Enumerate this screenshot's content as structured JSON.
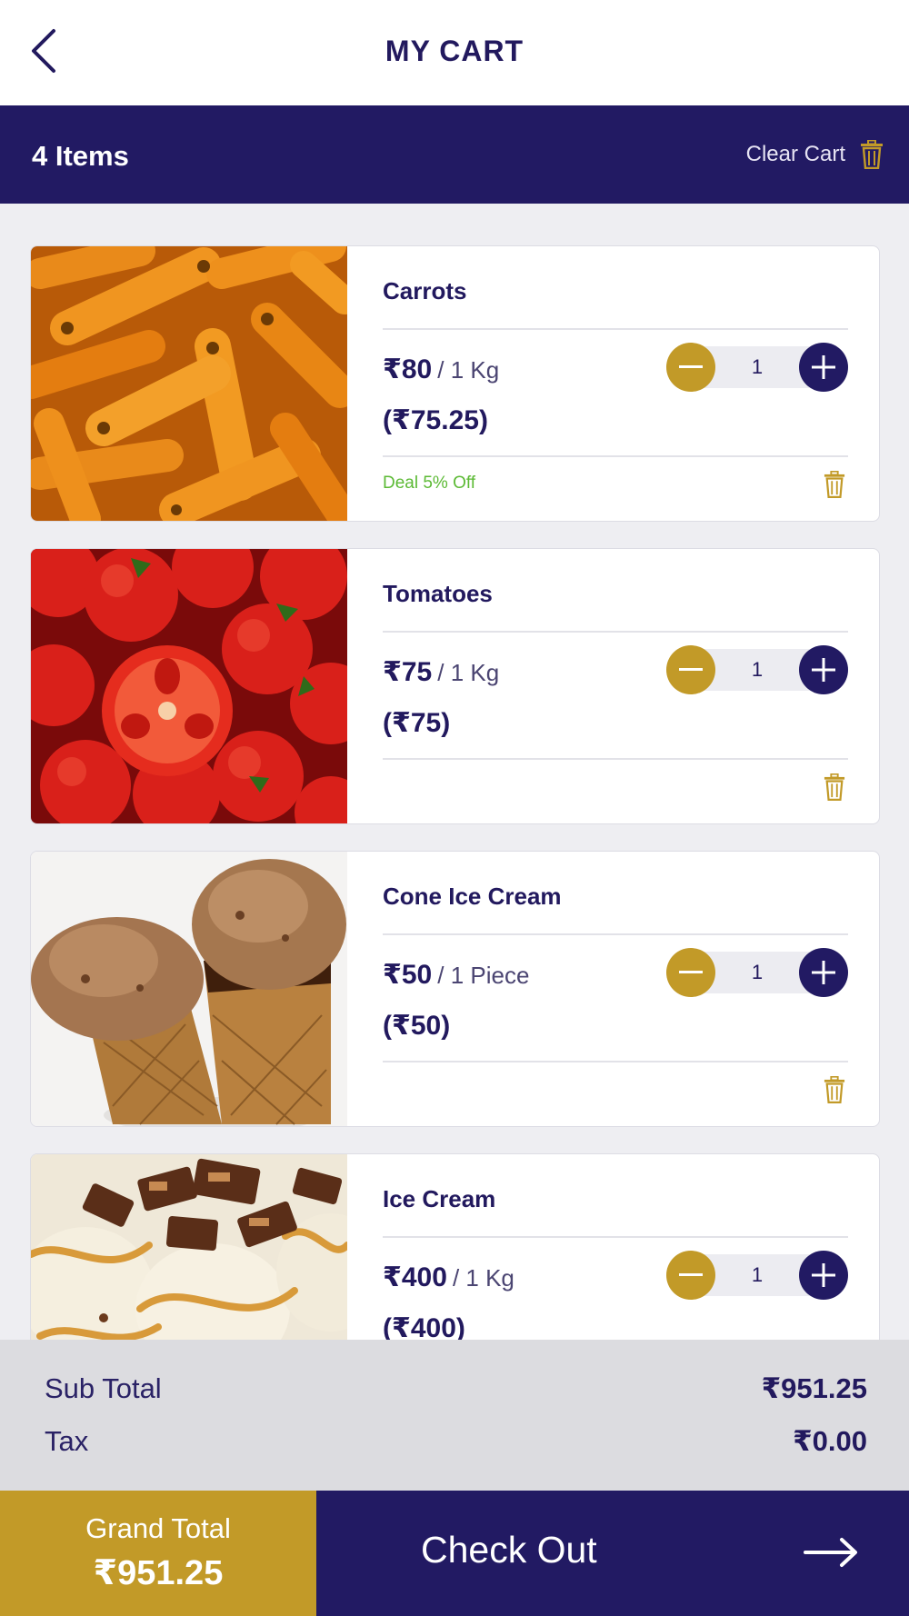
{
  "header": {
    "title": "MY CART",
    "back_icon": "chevron-left-icon"
  },
  "items_bar": {
    "count_label": "4 Items",
    "clear_cart_label": "Clear Cart",
    "clear_cart_icon": "trash-icon"
  },
  "items": [
    {
      "name": "Carrots",
      "price": "₹80",
      "unit": "/ 1 Kg",
      "effective_price": "(₹75.25)",
      "quantity": "1",
      "deal": "Deal 5% Off",
      "image": "carrots"
    },
    {
      "name": "Tomatoes",
      "price": "₹75",
      "unit": "/ 1 Kg",
      "effective_price": "(₹75)",
      "quantity": "1",
      "deal": "",
      "image": "tomatoes"
    },
    {
      "name": "Cone Ice Cream",
      "price": "₹50",
      "unit": "/ 1 Piece",
      "effective_price": "(₹50)",
      "quantity": "1",
      "deal": "",
      "image": "cone-ice-cream"
    },
    {
      "name": "Ice Cream",
      "price": "₹400",
      "unit": "/ 1 Kg",
      "effective_price": "(₹400)",
      "quantity": "1",
      "deal": "",
      "image": "ice-cream"
    }
  ],
  "totals": {
    "subtotal_label": "Sub Total",
    "subtotal_value": "₹951.25",
    "tax_label": "Tax",
    "tax_value": "₹0.00"
  },
  "footer": {
    "grand_total_label": "Grand Total",
    "grand_total_value": "₹951.25",
    "checkout_label": "Check Out",
    "checkout_icon": "arrow-right-icon"
  },
  "colors": {
    "brand": "#221a63",
    "accent": "#c29a28",
    "deal": "#5cba35",
    "background": "#eeeef2"
  }
}
